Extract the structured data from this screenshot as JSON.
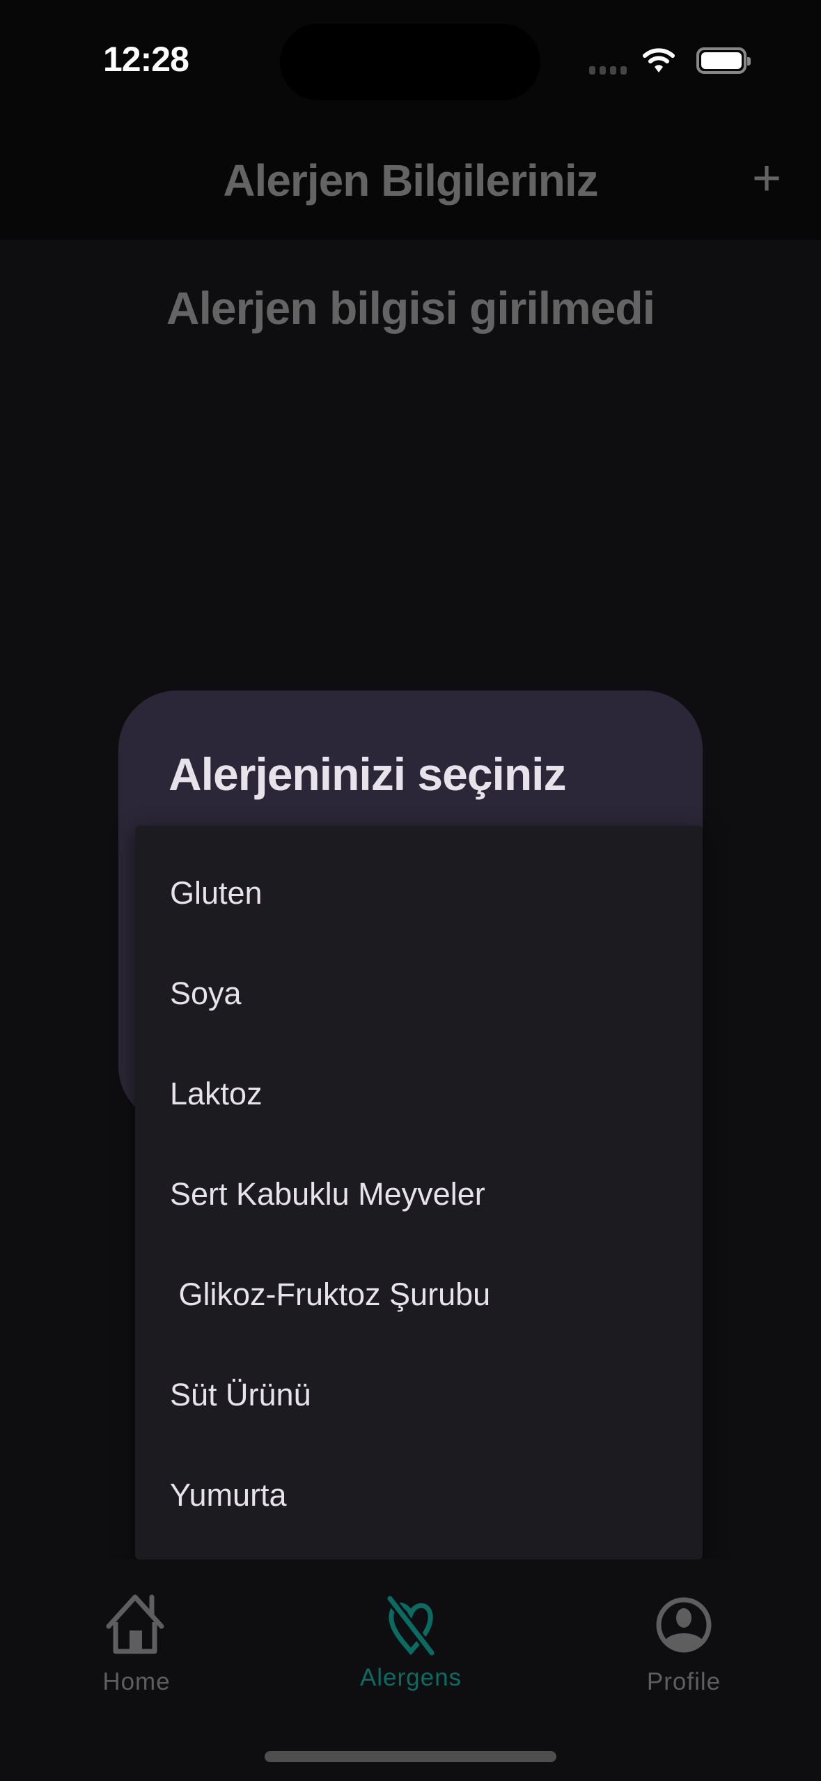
{
  "status_bar": {
    "time": "12:28"
  },
  "header": {
    "title": "Alerjen Bilgileriniz",
    "add_icon": "plus-icon"
  },
  "main": {
    "empty_message": "Alerjen bilgisi girilmedi"
  },
  "dialog": {
    "title": "Alerjeninizi seçiniz",
    "options": [
      {
        "label": "Gluten"
      },
      {
        "label": "Soya"
      },
      {
        "label": "Laktoz"
      },
      {
        "label": "Sert Kabuklu Meyveler"
      },
      {
        "label": " Glikoz-Fruktoz Şurubu"
      },
      {
        "label": "Süt Ürünü"
      },
      {
        "label": "Yumurta"
      }
    ]
  },
  "tab_bar": {
    "active_color": "#0a6b62",
    "items": [
      {
        "label": "Home",
        "icon": "home-icon"
      },
      {
        "label": "Alergens",
        "icon": "heart-slash-icon",
        "active": true
      },
      {
        "label": "Profile",
        "icon": "person-circle-icon"
      }
    ]
  }
}
